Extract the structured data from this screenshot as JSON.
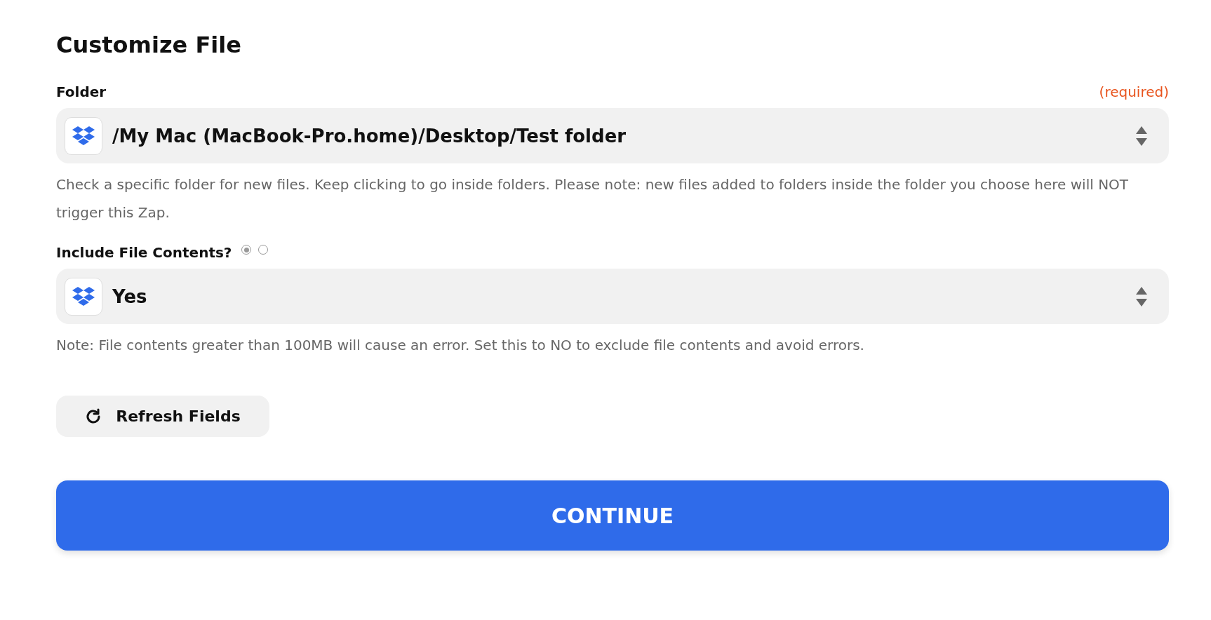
{
  "title": "Customize File",
  "fields": [
    {
      "label": "Folder",
      "required_note": "(required)",
      "value": "/My Mac (MacBook-Pro.home)/Desktop/Test folder",
      "help": "Check a specific folder for new files. Keep clicking to go inside folders. Please note: new files added to folders inside the folder you choose here will NOT trigger this Zap."
    },
    {
      "label": "Include File Contents?",
      "mode_radios": [
        {
          "selected": true
        },
        {
          "selected": false
        }
      ],
      "value": "Yes",
      "help": "Note: File contents greater than 100MB will cause an error. Set this to NO to exclude file contents and avoid errors."
    }
  ],
  "refresh_button": "Refresh Fields",
  "continue_button": "CONTINUE"
}
